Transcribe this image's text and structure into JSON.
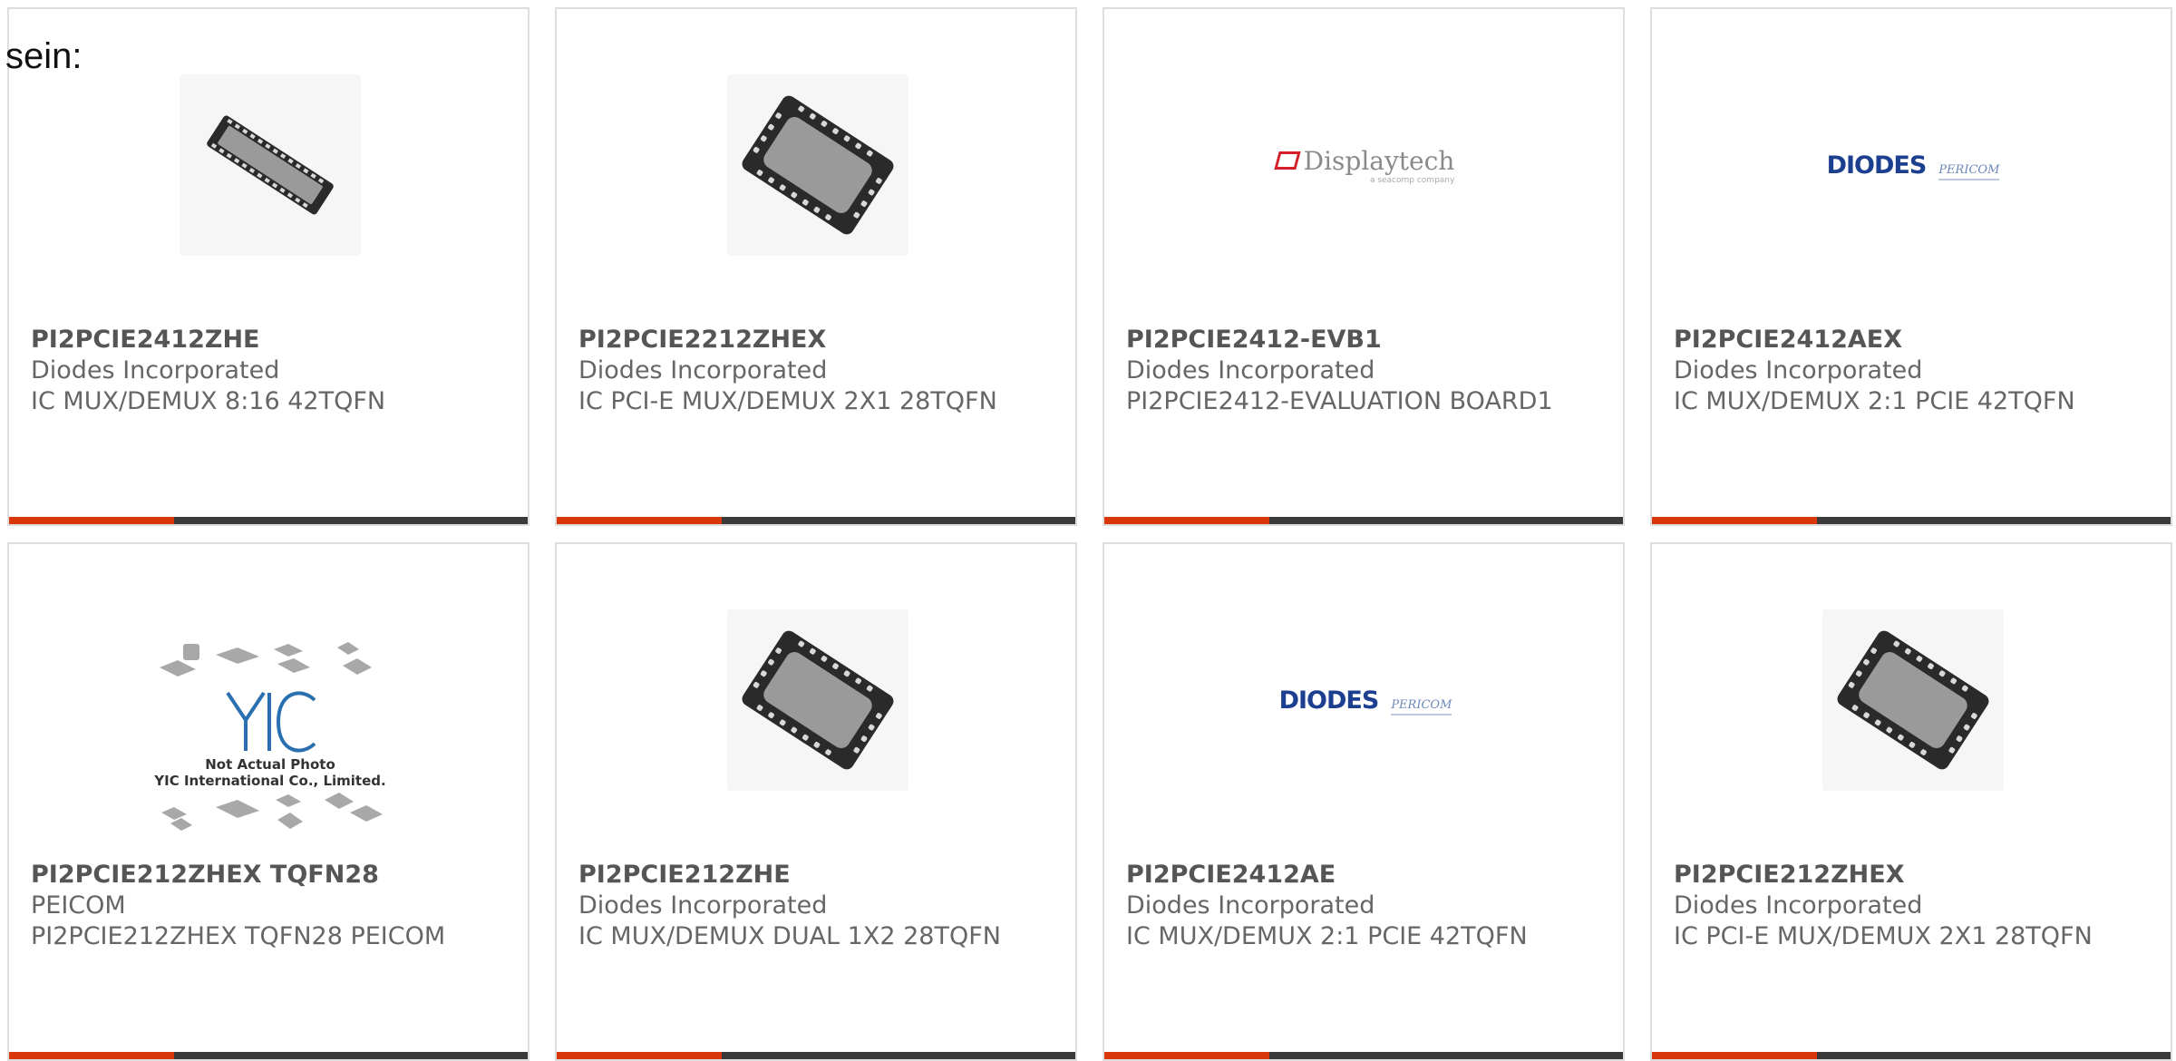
{
  "page_fragment": "sein:",
  "colors": {
    "accent": "#d9360b",
    "bar": "#3a3a3a",
    "card_border": "#dedede",
    "text": "#666666"
  },
  "products": [
    {
      "part_number": "PI2PCIE2412ZHE",
      "manufacturer": "Diodes Incorporated",
      "description": "IC MUX/DEMUX 8:16 42TQFN",
      "image": "qfn-chip-long-angled"
    },
    {
      "part_number": "PI2PCIE2212ZHEX",
      "manufacturer": "Diodes Incorporated",
      "description": "IC PCI-E MUX/DEMUX 2X1 28TQFN",
      "image": "qfn-chip"
    },
    {
      "part_number": "PI2PCIE2412-EVB1",
      "manufacturer": "Diodes Incorporated",
      "description": "PI2PCIE2412-EVALUATION BOARD1",
      "image": "displaytech-logo",
      "logo_text": "Displaytech",
      "logo_subtext": "a seacomp company"
    },
    {
      "part_number": "PI2PCIE2412AEX",
      "manufacturer": "Diodes Incorporated",
      "description": "IC MUX/DEMUX 2:1 PCIE 42TQFN",
      "image": "diodes-pericom-logo",
      "logo_text": "DIODES",
      "logo_subtext": "PERICOM"
    },
    {
      "part_number": "PI2PCIE212ZHEX TQFN28",
      "manufacturer": "PEICOM",
      "description": "PI2PCIE212ZHEX TQFN28 PEICOM",
      "image": "yic-placeholder",
      "logo_text": "YIC",
      "caption_line1": "Not Actual Photo",
      "caption_line2": "YIC International Co., Limited."
    },
    {
      "part_number": "PI2PCIE212ZHE",
      "manufacturer": "Diodes Incorporated",
      "description": "IC MUX/DEMUX DUAL 1X2 28TQFN",
      "image": "qfn-chip"
    },
    {
      "part_number": "PI2PCIE2412AE",
      "manufacturer": "Diodes Incorporated",
      "description": "IC MUX/DEMUX 2:1 PCIE 42TQFN",
      "image": "diodes-pericom-logo",
      "logo_text": "DIODES",
      "logo_subtext": "PERICOM"
    },
    {
      "part_number": "PI2PCIE212ZHEX",
      "manufacturer": "Diodes Incorporated",
      "description": "IC PCI-E MUX/DEMUX 2X1 28TQFN",
      "image": "qfn-chip"
    }
  ]
}
